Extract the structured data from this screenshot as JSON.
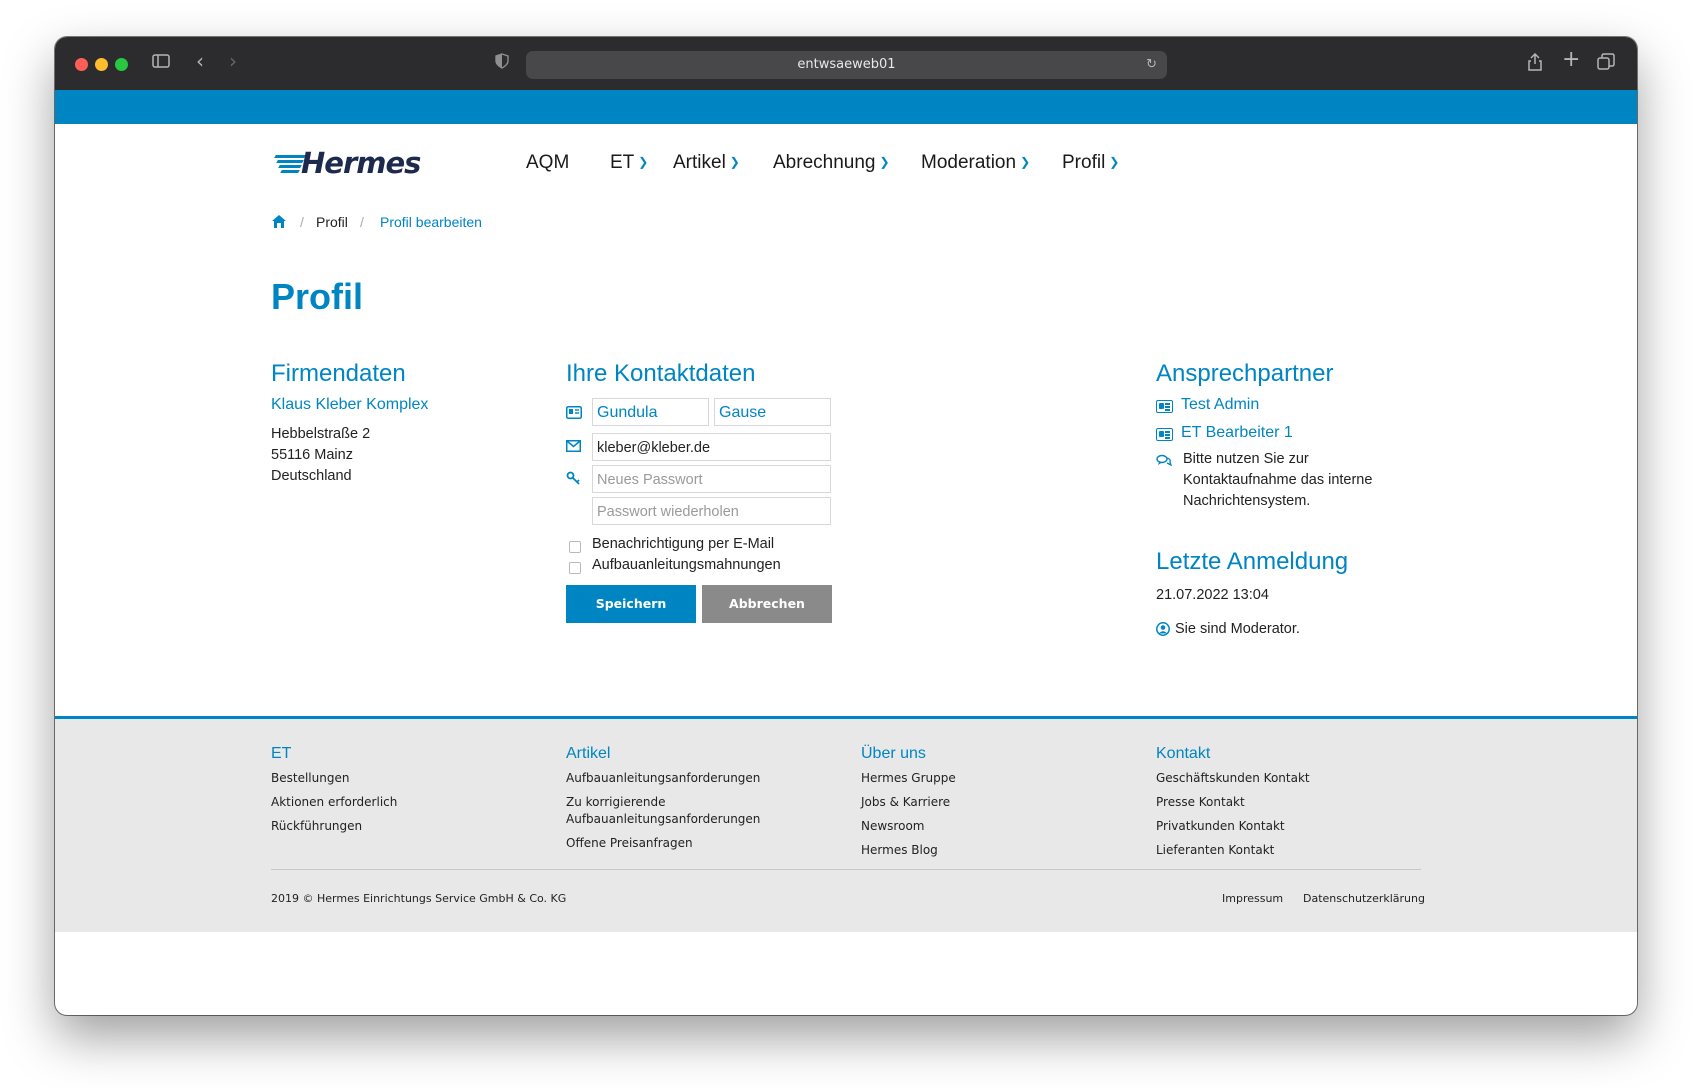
{
  "browser": {
    "url": "entwsaeweb01"
  },
  "nav": {
    "brand": "Hermes",
    "items": [
      {
        "label": "AQM"
      },
      {
        "label": "ET"
      },
      {
        "label": "Artikel"
      },
      {
        "label": "Abrechnung"
      },
      {
        "label": "Moderation"
      },
      {
        "label": "Profil"
      }
    ]
  },
  "breadcrumb": {
    "items": [
      "Profil",
      "Profil bearbeiten"
    ]
  },
  "page_title": "Profil",
  "firmendaten": {
    "heading": "Firmendaten",
    "company": "Klaus Kleber Komplex",
    "street": "Hebbelstraße 2",
    "city": "55116 Mainz",
    "country": "Deutschland"
  },
  "kontakt": {
    "heading": "Ihre Kontaktdaten",
    "first_name": "Gundula",
    "last_name": "Gause",
    "email": "kleber@kleber.de",
    "password_placeholder": "Neues Passwort",
    "password_repeat_placeholder": "Passwort wiederholen",
    "checkbox_email": "Benachrichtigung per E-Mail",
    "checkbox_reminders": "Aufbauanleitungsmahnungen",
    "save_label": "Speichern",
    "cancel_label": "Abbrechen"
  },
  "ansprechpartner": {
    "heading": "Ansprechpartner",
    "contacts": [
      "Test Admin",
      "ET Bearbeiter 1"
    ],
    "note_line1": "Bitte nutzen Sie zur",
    "note_line2": "Kontaktaufnahme das interne",
    "note_line3": "Nachrichtensystem."
  },
  "letzte_anmeldung": {
    "heading": "Letzte Anmeldung",
    "datetime": "21.07.2022 13:04",
    "role": "Sie sind Moderator."
  },
  "footer": {
    "columns": [
      {
        "heading": "ET",
        "links": [
          "Bestellungen",
          "Aktionen erforderlich",
          "Rückführungen"
        ]
      },
      {
        "heading": "Artikel",
        "links": [
          "Aufbauanleitungsanforderungen",
          "Zu korrigierende",
          "Aufbauanleitungsanforderungen",
          "Offene Preisanfragen"
        ]
      },
      {
        "heading": "Über uns",
        "links": [
          "Hermes Gruppe",
          "Jobs & Karriere",
          "Newsroom",
          "Hermes Blog"
        ]
      },
      {
        "heading": "Kontakt",
        "links": [
          "Geschäftskunden Kontakt",
          "Presse Kontakt",
          "Privatkunden Kontakt",
          "Lieferanten Kontakt"
        ]
      }
    ],
    "copyright": "2019 © Hermes Einrichtungs Service GmbH & Co. KG",
    "impressum": "Impressum",
    "datenschutz": "Datenschutzerklärung"
  },
  "colors": {
    "accent": "#0085c3",
    "footer_bg": "#e8e8e8",
    "cancel_button": "#8a8a8a"
  }
}
